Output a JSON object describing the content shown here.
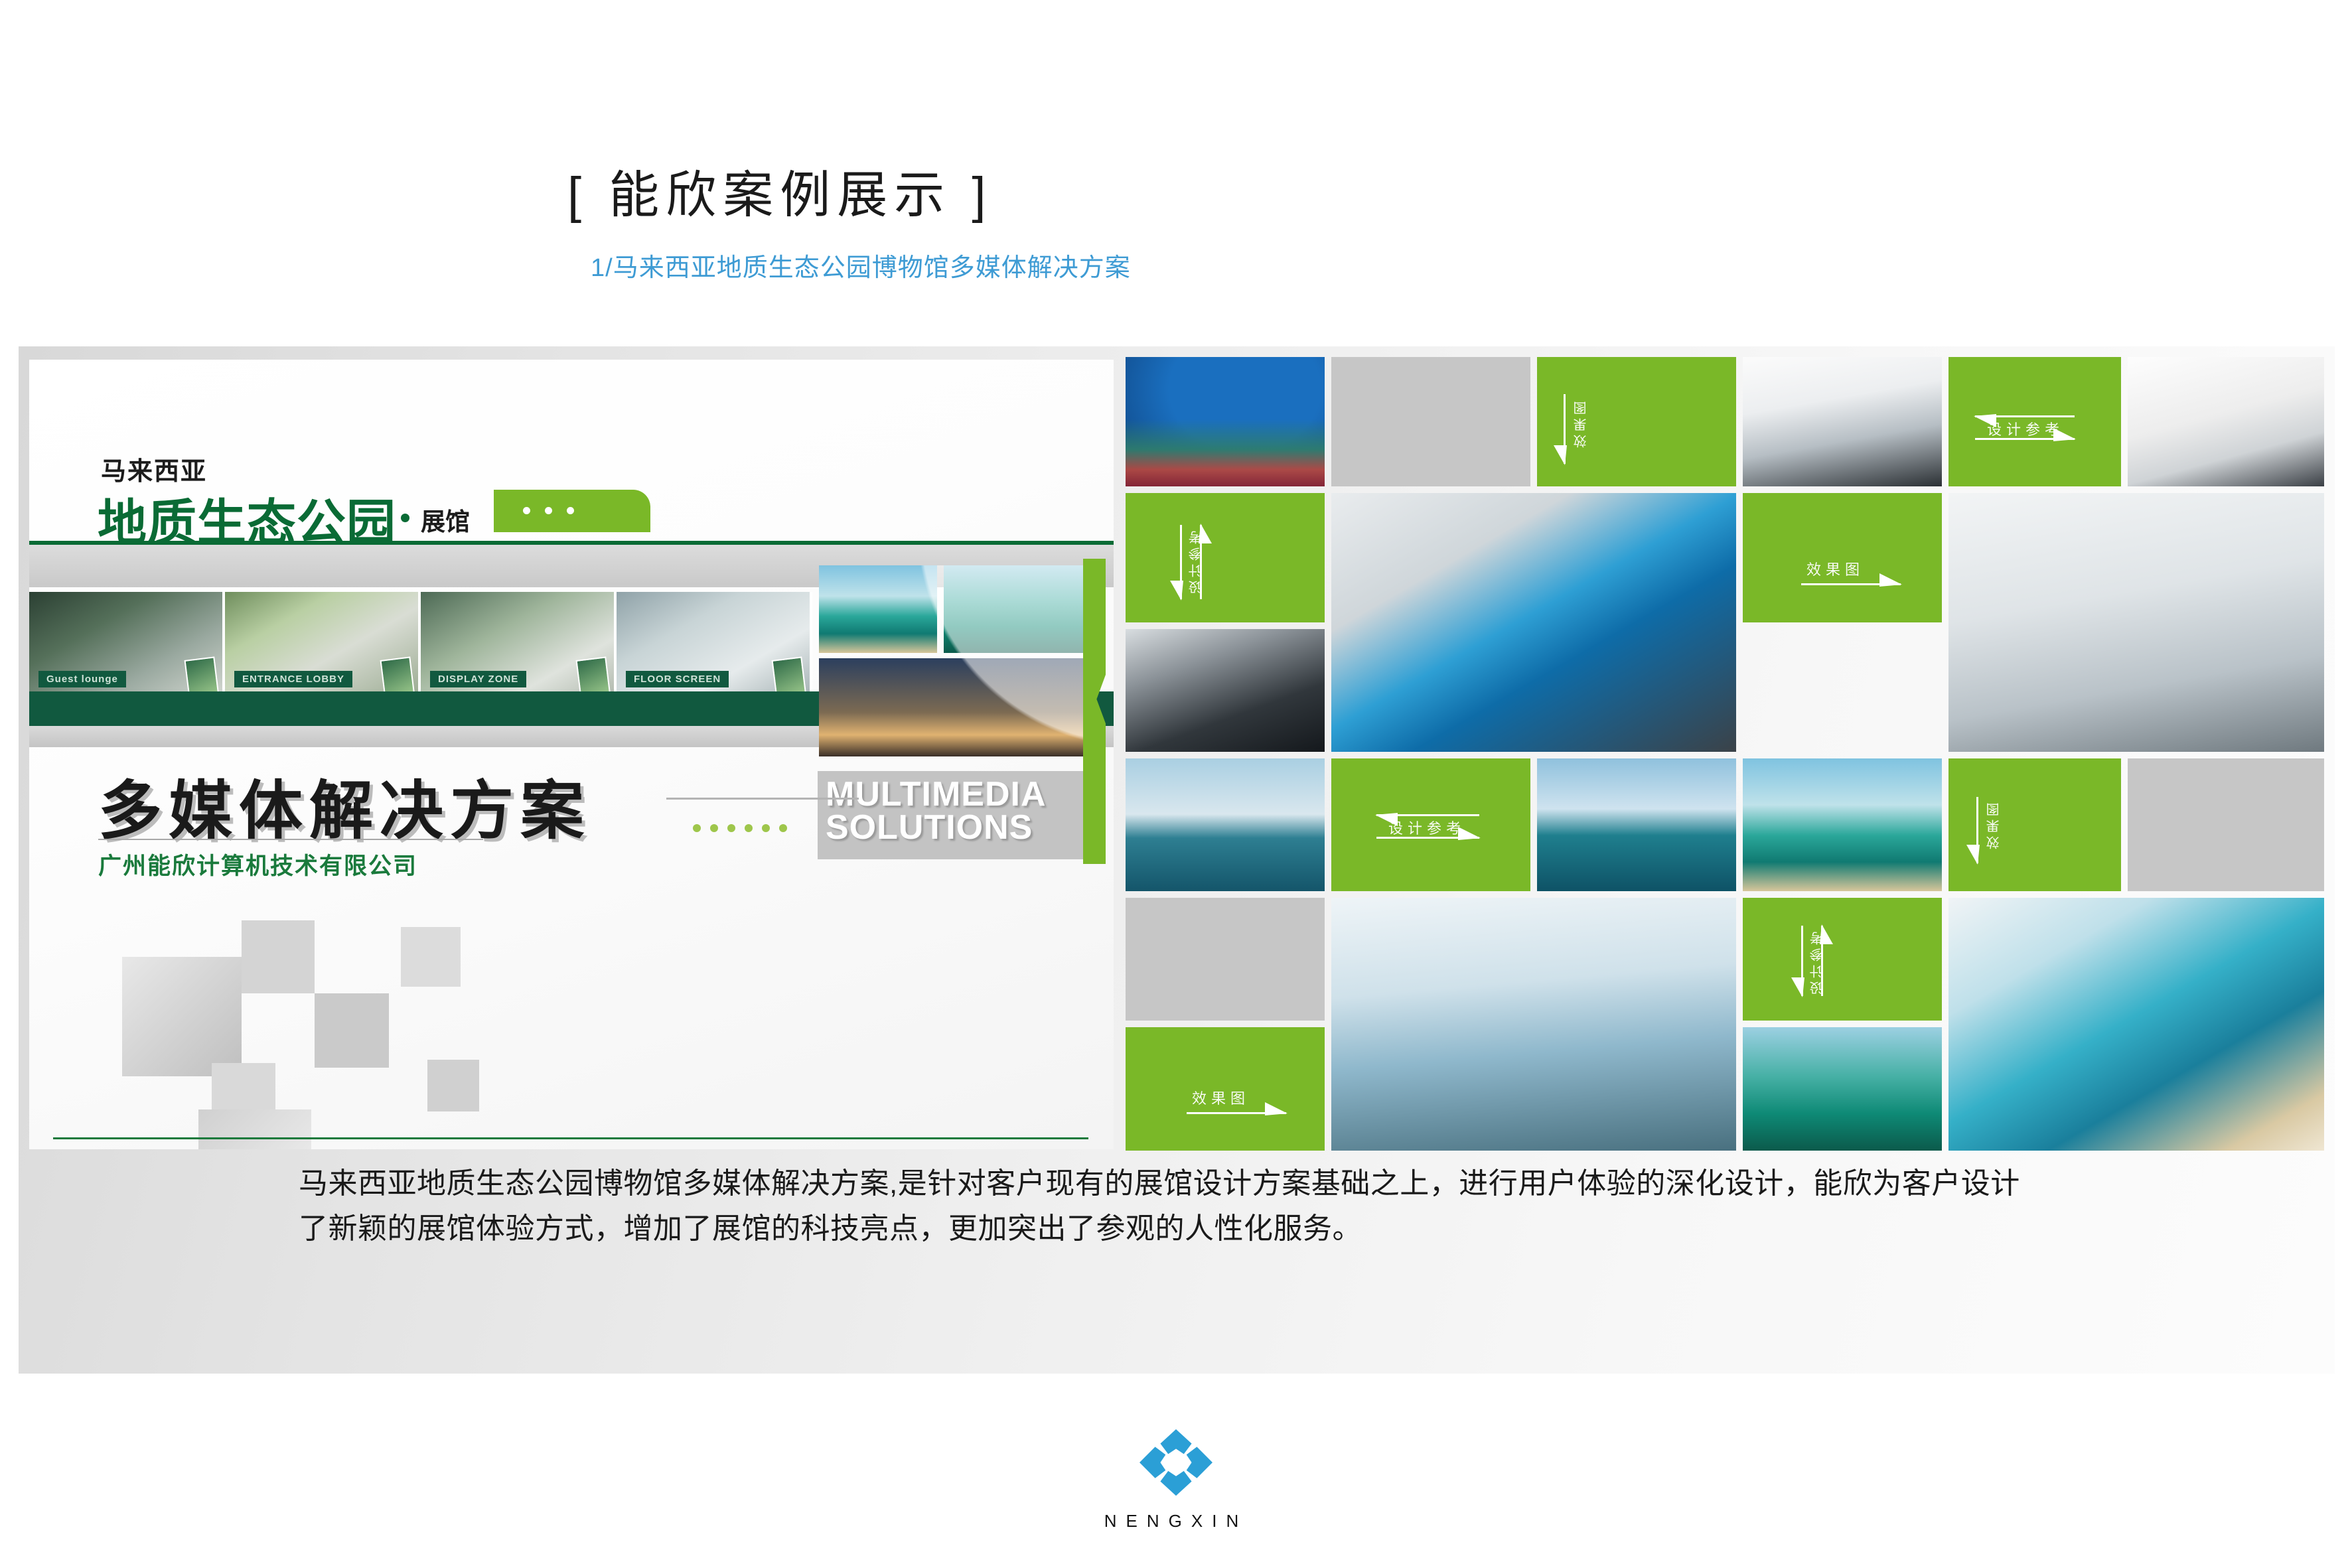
{
  "header": {
    "title": "[ 能欣案例展示 ]",
    "subtitle": "1/马来西亚地质生态公园博物馆多媒体解决方案",
    "subtitle_color": "#3e9bd4"
  },
  "poster": {
    "country": "马来西亚",
    "name": "地质生态公园",
    "separator": "·",
    "sub": "展馆",
    "big_title": "多媒体解决方案",
    "english_line1": "MULTIMEDIA",
    "english_line2": "SOLUTIONS",
    "company": "广州能欣计算机技术有限公司",
    "thumbs": [
      {
        "caption": "Guest lounge"
      },
      {
        "caption": "ENTRANCE LOBBY"
      },
      {
        "caption": "DISPLAY ZONE"
      },
      {
        "caption": "FLOOR SCREEN"
      }
    ]
  },
  "grid": {
    "green_color": "#7ab828",
    "gray_color": "#c6c6c6",
    "labels": {
      "effect": "效果图",
      "reference": "设计参考"
    },
    "cells": [
      {
        "name": "coral-reef-photo",
        "kind": "photo"
      },
      {
        "name": "placeholder-gray",
        "kind": "gray"
      },
      {
        "name": "effect-label-top",
        "kind": "green",
        "label": "效果图"
      },
      {
        "name": "white-interior-photo",
        "kind": "photo"
      },
      {
        "name": "reference-label-top",
        "kind": "green",
        "label": "设计参考"
      },
      {
        "name": "bright-hall-photo",
        "kind": "photo"
      },
      {
        "name": "reference-label-left",
        "kind": "green",
        "label": "设计参考"
      },
      {
        "name": "aquarium-wall-photo",
        "kind": "photo"
      },
      {
        "name": "effect-label-mid",
        "kind": "green",
        "label": "效果图"
      },
      {
        "name": "exhibit-table-photo",
        "kind": "photo"
      },
      {
        "name": "dark-corridor-photo",
        "kind": "photo"
      },
      {
        "name": "windsurf-photo-a",
        "kind": "photo"
      },
      {
        "name": "reference-label-mid",
        "kind": "green",
        "label": "设计参考"
      },
      {
        "name": "windsurf-photo-b",
        "kind": "photo"
      },
      {
        "name": "tropical-beach-photo",
        "kind": "photo"
      },
      {
        "name": "effect-label-right",
        "kind": "green",
        "label": "效果图"
      },
      {
        "name": "effect-label-bottom",
        "kind": "green",
        "label": "效果图"
      },
      {
        "name": "sail-hall-photo",
        "kind": "photo"
      },
      {
        "name": "reference-label-bottom",
        "kind": "green",
        "label": "设计参考"
      },
      {
        "name": "boat-sea-photo",
        "kind": "photo"
      },
      {
        "name": "pool-3d-photo",
        "kind": "photo"
      }
    ]
  },
  "caption": {
    "text": "马来西亚地质生态公园博物馆多媒体解决方案,是针对客户现有的展馆设计方案基础之上，进行用户体验的深化设计，能欣为客户设计了新颖的展馆体验方式，增加了展馆的科技亮点，更加突出了参观的人性化服务。"
  },
  "footer": {
    "brand": "NENGXIN",
    "logo_color": "#2b9fd6"
  }
}
